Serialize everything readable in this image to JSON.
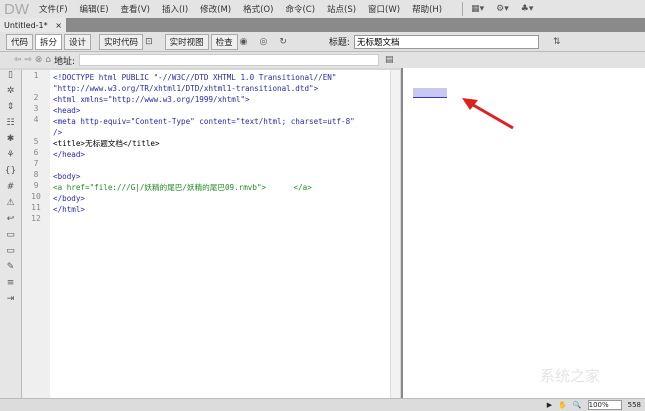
{
  "menubar": {
    "logo": "DW",
    "items": [
      "文件(F)",
      "编辑(E)",
      "查看(V)",
      "插入(I)",
      "修改(M)",
      "格式(O)",
      "命令(C)",
      "站点(S)",
      "窗口(W)",
      "帮助(H)"
    ]
  },
  "tab": {
    "label": "Untitled-1*",
    "close": "×"
  },
  "toolbar": {
    "code": "代码",
    "split": "拆分",
    "design": "设计",
    "live_code": "实时代码",
    "live_view": "实时视图",
    "inspect": "检查",
    "title_label": "标题:",
    "title_value": "无标题文档"
  },
  "address": {
    "label": "地址:",
    "value": ""
  },
  "code_lines": [
    {
      "n": "1",
      "t": "<!DOCTYPE html PUBLIC \"-//W3C//DTD XHTML 1.0 Transitional//EN\""
    },
    {
      "n": "",
      "t": "\"http://www.w3.org/TR/xhtml1/DTD/xhtml1-transitional.dtd\">"
    },
    {
      "n": "2",
      "t": "<html xmlns=\"http://www.w3.org/1999/xhtml\">"
    },
    {
      "n": "3",
      "t": "<head>"
    },
    {
      "n": "4",
      "t": "<meta http-equiv=\"Content-Type\" content=\"text/html; charset=utf-8\""
    },
    {
      "n": "",
      "t": "/>"
    },
    {
      "n": "5",
      "t": "<title>无标题文档</title>"
    },
    {
      "n": "6",
      "t": "</head>"
    },
    {
      "n": "7",
      "t": ""
    },
    {
      "n": "8",
      "t": "<body>"
    },
    {
      "n": "9",
      "t": "<a href=\"file:///G|/妖精的尾巴/妖精的尾巴09.rmvb\">      </a>"
    },
    {
      "n": "10",
      "t": "</body>"
    },
    {
      "n": "11",
      "t": "</html>"
    },
    {
      "n": "12",
      "t": ""
    }
  ],
  "status": {
    "zoom": "100%",
    "size": "558"
  },
  "watermark": "系统之家"
}
